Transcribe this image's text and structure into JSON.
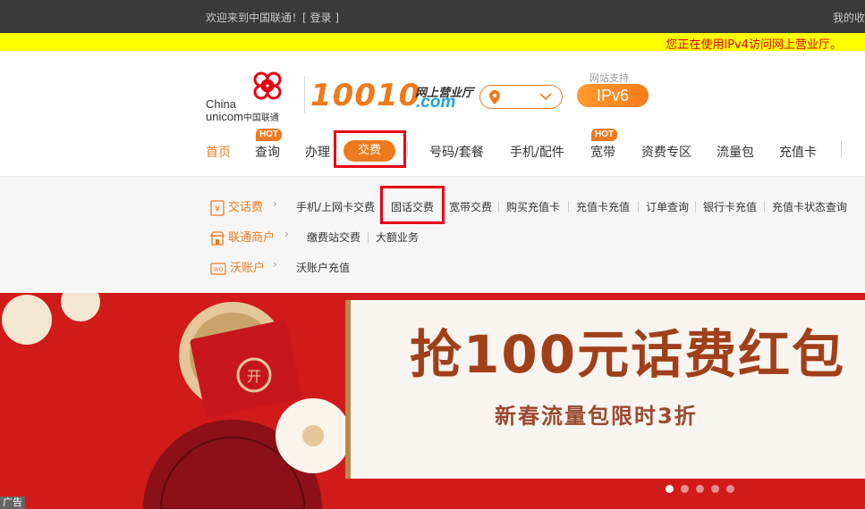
{
  "topbar": {
    "welcome": "欢迎来到中国联通！",
    "login": "[ 登录 ]",
    "mine": "我的收"
  },
  "notice": "您正在使用IPv4访问网上营业厅。",
  "logo": {
    "china": "China",
    "unicom": "unicom",
    "cn_name": "中国联通"
  },
  "brand": {
    "number": "10010",
    "sub": "网上营业厅",
    "com": ".com"
  },
  "ipv6": {
    "caption": "网站支持",
    "badge": "IPv6"
  },
  "nav": {
    "home": "首页",
    "query": "查询",
    "handle": "办理",
    "pay": "交费",
    "number": "号码/套餐",
    "phone": "手机/配件",
    "broadband": "宽带",
    "tariff": "资费专区",
    "traffic": "流量包",
    "card": "充值卡",
    "hot": "HOT"
  },
  "dropdown": {
    "row1": {
      "category": "交话费",
      "links": [
        "手机/上网卡交费",
        "固话交费",
        "宽带交费",
        "购买充值卡",
        "充值卡充值",
        "订单查询",
        "银行卡充值",
        "充值卡状态查询"
      ]
    },
    "row2": {
      "category": "联通商户",
      "links": [
        "缴费站交费",
        "大额业务"
      ]
    },
    "row3": {
      "category": "沃账户",
      "links": [
        "沃账户充值"
      ]
    }
  },
  "banner": {
    "headline": "抢100元话费红包",
    "sub": "新春流量包限时3折",
    "ad": "广告",
    "envelope_char": "开"
  },
  "colors": {
    "accent": "#ee7a1e",
    "highlight": "#e60012",
    "notice_bg": "#ffff00",
    "topbar_bg": "#3a3a3a"
  }
}
